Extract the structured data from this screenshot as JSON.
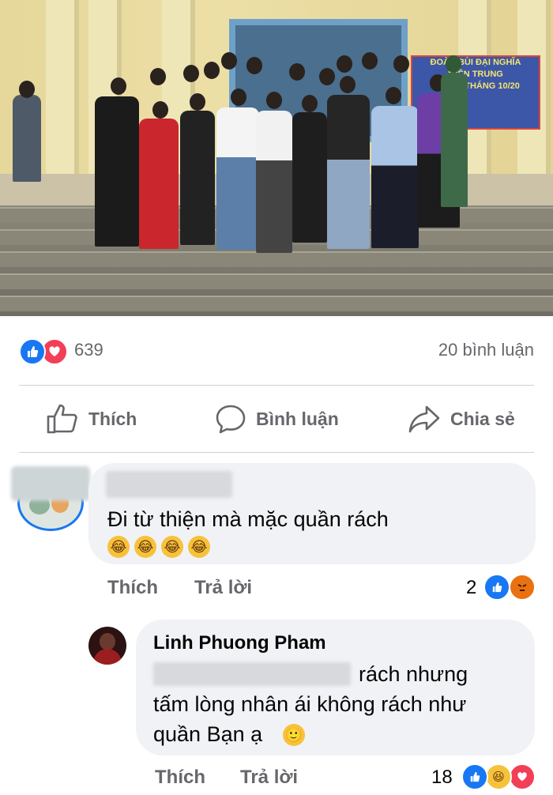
{
  "post": {
    "banner_lines": [
      "ĐOÀN BÙI ĐẠI NGHĨA",
      "MIỀN TRUNG",
      "LŨ LỤT THÁNG 10/20"
    ],
    "reaction_icons": [
      "like-icon",
      "love-icon"
    ],
    "reaction_count": "639",
    "comment_count": "20 bình luận"
  },
  "actions": {
    "like": "Thích",
    "comment": "Bình luận",
    "share": "Chia sẻ"
  },
  "comments": [
    {
      "text": "Đi từ thiện mà mặc quần rách",
      "emojis": [
        "rofl-emoji",
        "rofl-emoji",
        "rofl-emoji",
        "rofl-emoji"
      ],
      "like_label": "Thích",
      "reply_label": "Trả lời",
      "reaction_count": "2",
      "reaction_icons": [
        "like-icon",
        "angry-icon"
      ]
    }
  ],
  "reply": {
    "author": "Linh Phuong Pham",
    "line1_visible": "rách nhưng",
    "line2": "tấm lòng nhân ái không rách như",
    "line3": "quần Bạn ạ",
    "emoji": "smile-emoji",
    "like_label": "Thích",
    "reply_label": "Trả lời",
    "reaction_count": "18",
    "reaction_icons": [
      "like-icon",
      "haha-icon",
      "love-icon"
    ]
  },
  "colors": {
    "facebook_blue": "#1877f2",
    "love_red": "#f33e58",
    "meta_gray": "#65676b",
    "bubble_gray": "#f0f2f5"
  }
}
